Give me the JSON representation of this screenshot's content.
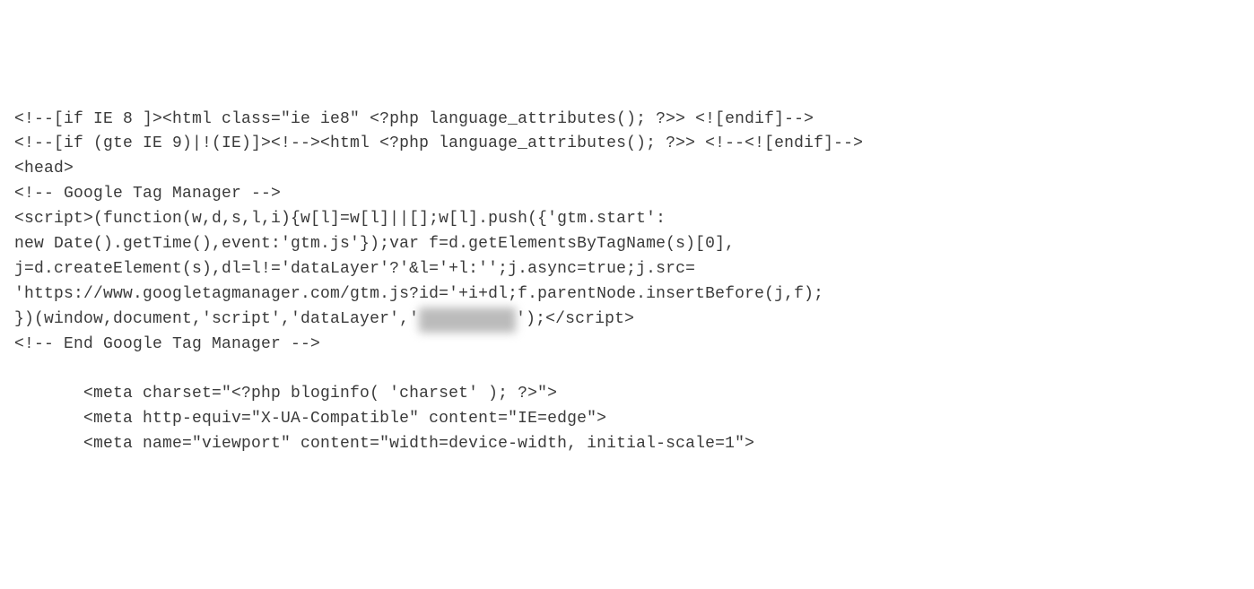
{
  "code": {
    "line1": "<!--[if IE 8 ]><html class=\"ie ie8\" <?php language_attributes(); ?>> <![endif]-->",
    "line2": "<!--[if (gte IE 9)|!(IE)]><!--><html <?php language_attributes(); ?>> <!--<![endif]-->",
    "line3": "<head>",
    "line4": "<!-- Google Tag Manager -->",
    "line5": "<script>(function(w,d,s,l,i){w[l]=w[l]||[];w[l].push({'gtm.start':",
    "line6": "new Date().getTime(),event:'gtm.js'});var f=d.getElementsByTagName(s)[0],",
    "line7": "j=d.createElement(s),dl=l!='dataLayer'?'&l='+l:'';j.async=true;j.src=",
    "line8": "'https://www.googletagmanager.com/gtm.js?id='+i+dl;f.parentNode.insertBefore(j,f);",
    "line9_pre": "})(window,document,'script','dataLayer','",
    "line9_blur": "GTM-XXXXXX",
    "line9_post": "');</script>",
    "line10": "<!-- End Google Tag Manager -->",
    "line11": "",
    "line12": "       <meta charset=\"<?php bloginfo( 'charset' ); ?>\">",
    "line13": "       <meta http-equiv=\"X-UA-Compatible\" content=\"IE=edge\">",
    "line14": "       <meta name=\"viewport\" content=\"width=device-width, initial-scale=1\">"
  }
}
